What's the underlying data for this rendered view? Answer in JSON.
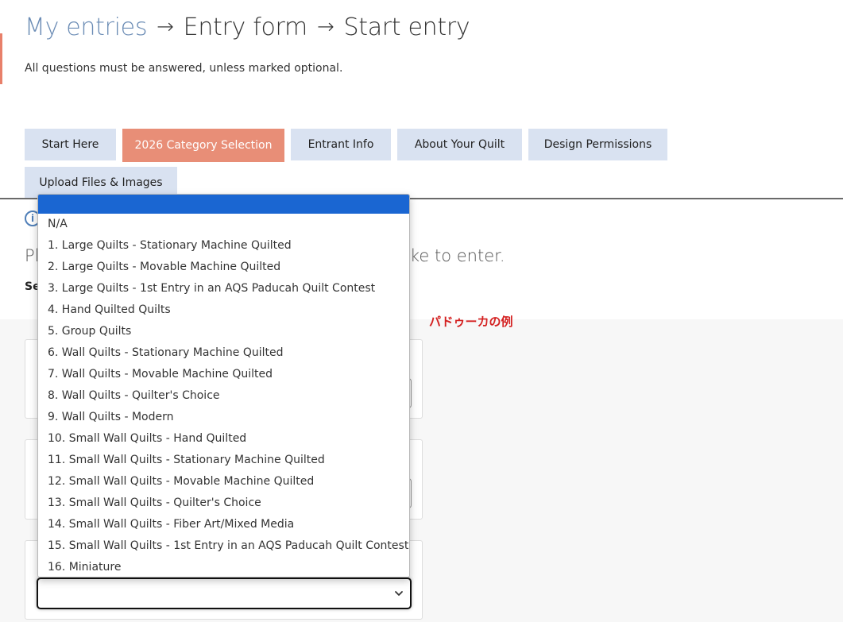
{
  "breadcrumb": {
    "link": "My entries",
    "arrow": "→",
    "items": [
      "Entry form",
      "Start entry"
    ]
  },
  "intro": "All questions must be answered, unless marked optional.",
  "tabs": [
    {
      "label": "Start Here",
      "active": false
    },
    {
      "label": "2026 Category Selection",
      "active": true
    },
    {
      "label": "Entrant Info",
      "active": false
    },
    {
      "label": "About Your Quilt",
      "active": false
    },
    {
      "label": "Design Permissions",
      "active": false
    },
    {
      "label": "Upload Files & Images",
      "active": false
    }
  ],
  "info_icon": "info-icon",
  "prompt": {
    "left_fragment": "Pl",
    "right_fragment": "ke to enter."
  },
  "sub_fragment": "Se",
  "annotation": "パドゥーカの例",
  "dropdown": {
    "selected": "",
    "options": [
      "N/A",
      "1. Large Quilts - Stationary Machine Quilted",
      "2. Large Quilts - Movable Machine Quilted",
      "3. Large Quilts - 1st Entry in an AQS Paducah Quilt Contest",
      "4. Hand Quilted Quilts",
      "5. Group Quilts",
      "6. Wall Quilts - Stationary Machine Quilted",
      "7. Wall Quilts - Movable Machine Quilted",
      "8. Wall Quilts - Quilter's Choice",
      "9. Wall Quilts - Modern",
      "10. Small Wall Quilts - Hand Quilted",
      "11. Small Wall Quilts - Stationary Machine Quilted",
      "12. Small Wall Quilts - Movable Machine Quilted",
      "13. Small Wall Quilts - Quilter's Choice",
      "14. Small Wall Quilts - Fiber Art/Mixed Media",
      "15. Small Wall Quilts - 1st Entry in an AQS Paducah Quilt Contest",
      "16. Miniature"
    ]
  },
  "colors": {
    "accent": "#e88e77",
    "tab_bg": "#d9e2f1",
    "link": "#6b8cb5",
    "highlight": "#1a66d2",
    "annotation": "#d42020"
  }
}
